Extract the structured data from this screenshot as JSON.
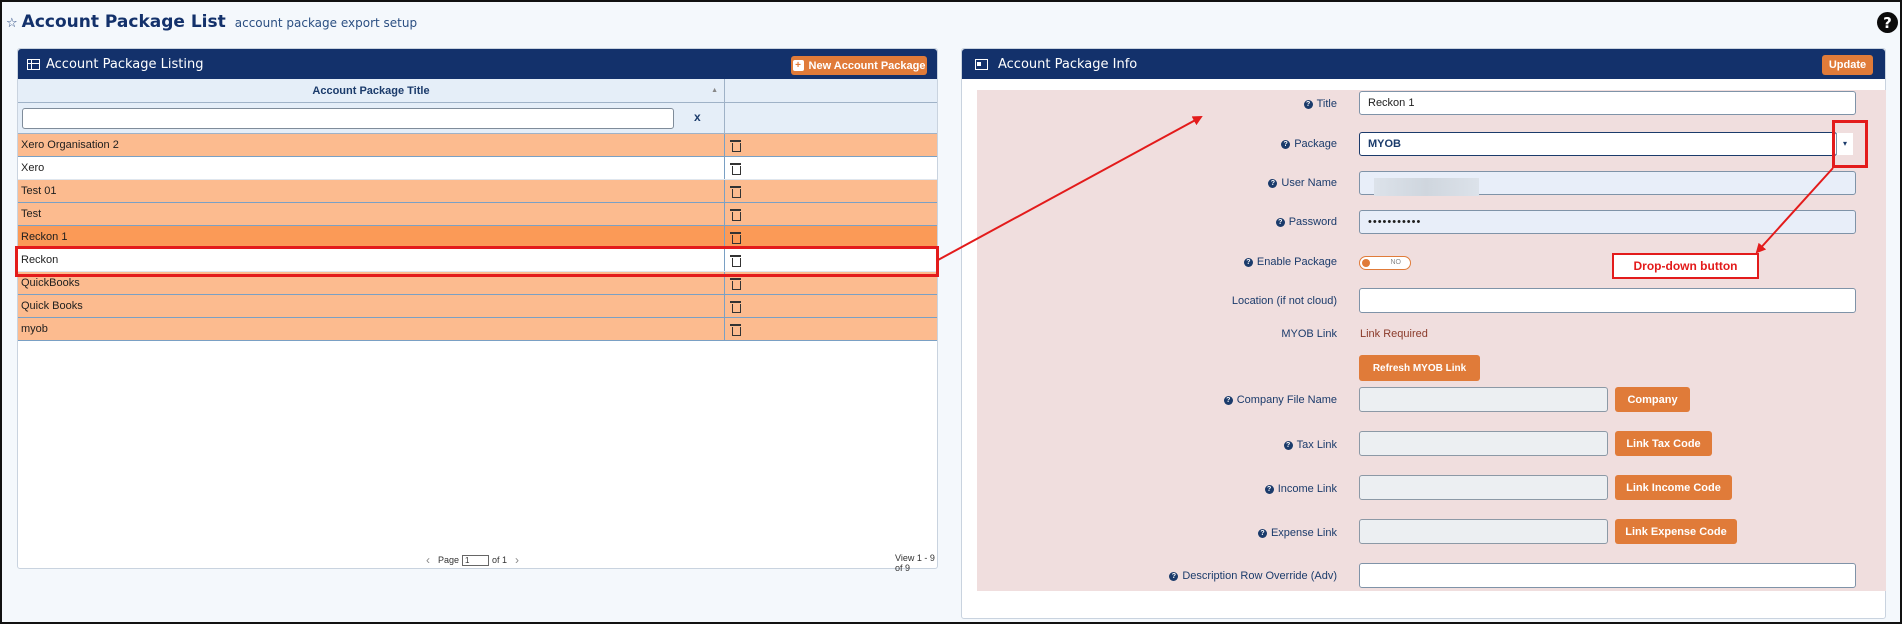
{
  "header": {
    "title": "Account Package List",
    "subtitle": "account package export setup",
    "help_label": "?"
  },
  "listing": {
    "title": "Account Package Listing",
    "new_button": "New Account Package",
    "column_title": "Account Package Title",
    "filter_clear": "x",
    "rows": [
      {
        "title": "Xero Organisation 2"
      },
      {
        "title": "Xero"
      },
      {
        "title": "Test 01"
      },
      {
        "title": "Test"
      },
      {
        "title": "Reckon 1",
        "selected": true
      },
      {
        "title": "Reckon"
      },
      {
        "title": "QuickBooks"
      },
      {
        "title": "Quick Books"
      },
      {
        "title": "myob"
      }
    ],
    "pager": {
      "page_label": "Page",
      "page_value": "1",
      "of_label": "of 1"
    },
    "view_info": "View 1 - 9 of 9"
  },
  "info": {
    "title": "Account Package Info",
    "update_button": "Update",
    "fields": {
      "title_label": "Title",
      "title_value": "Reckon 1",
      "package_label": "Package",
      "package_value": "MYOB",
      "username_label": "User Name",
      "password_label": "Password",
      "password_value": "•••••••••••",
      "enable_label": "Enable Package",
      "enable_value": "NO",
      "location_label": "Location (if not cloud)",
      "myob_link_label": "MYOB Link",
      "myob_link_value": "Link Required",
      "refresh_button": "Refresh MYOB Link",
      "company_file_label": "Company File Name",
      "company_button": "Company",
      "tax_link_label": "Tax Link",
      "tax_button": "Link Tax Code",
      "income_link_label": "Income Link",
      "income_button": "Link Income Code",
      "expense_link_label": "Expense Link",
      "expense_button": "Link Expense Code",
      "description_label": "Description Row Override (Adv)"
    }
  },
  "annotation": {
    "dropdown_label": "Drop-down button"
  },
  "colors": {
    "navy": "#13316b",
    "orange": "#e07b39",
    "row_highlight": "#fcbb8f",
    "annotation_red": "#e31b1b"
  }
}
